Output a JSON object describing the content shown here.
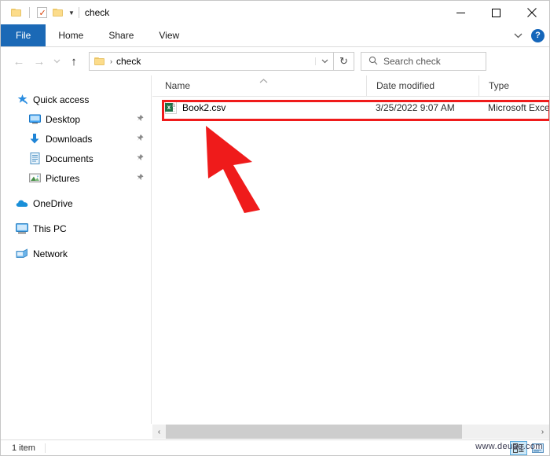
{
  "window": {
    "title": "check",
    "quick_access_toolbar": [
      {
        "name": "folder-properties",
        "icon": "folder-icon"
      },
      {
        "name": "properties",
        "icon": "properties-checkmark-icon"
      },
      {
        "name": "new-folder",
        "icon": "folder-icon"
      }
    ],
    "controls": {
      "minimize": "—",
      "maximize": "☐",
      "close": "✕"
    }
  },
  "ribbon": {
    "tabs": [
      {
        "label": "File",
        "active": true
      },
      {
        "label": "Home",
        "active": false
      },
      {
        "label": "Share",
        "active": false
      },
      {
        "label": "View",
        "active": false
      }
    ],
    "collapse_caret": "⌄",
    "help_label": "?"
  },
  "navigation": {
    "back": "←",
    "forward": "→",
    "recent": "⌄",
    "up": "↑",
    "address": {
      "folder": "check",
      "separator": "›",
      "dropdown_caret": "⌄"
    },
    "refresh": "↻",
    "search": {
      "placeholder": "Search check",
      "icon": "search-icon"
    }
  },
  "sidebar": {
    "items": [
      {
        "label": "Quick access",
        "icon": "star-pin-icon",
        "level": 0,
        "pinned": false
      },
      {
        "label": "Desktop",
        "icon": "desktop-icon",
        "level": 1,
        "pinned": true
      },
      {
        "label": "Downloads",
        "icon": "download-arrow-icon",
        "level": 1,
        "pinned": true
      },
      {
        "label": "Documents",
        "icon": "documents-icon",
        "level": 1,
        "pinned": true
      },
      {
        "label": "Pictures",
        "icon": "pictures-icon",
        "level": 1,
        "pinned": true
      },
      {
        "label": "OneDrive",
        "icon": "cloud-icon",
        "level": 0,
        "pinned": false
      },
      {
        "label": "This PC",
        "icon": "computer-icon",
        "level": 0,
        "pinned": false
      },
      {
        "label": "Network",
        "icon": "network-icon",
        "level": 0,
        "pinned": false
      }
    ],
    "pin_glyph": "📌"
  },
  "file_list": {
    "columns": [
      {
        "label": "Name",
        "sorted": "asc"
      },
      {
        "label": "Date modified",
        "sorted": ""
      },
      {
        "label": "Type",
        "sorted": ""
      }
    ],
    "sort_caret": "⌃",
    "rows": [
      {
        "name": "Book2.csv",
        "date_modified": "3/25/2022 9:07 AM",
        "type": "Microsoft Excel",
        "icon": "excel-csv-icon",
        "icon_badge": "x",
        "icon_letter": "a"
      }
    ]
  },
  "annotations": {
    "highlight_color": "#ef1b1b",
    "arrow_color": "#ef1b1b",
    "highlight_target": "Book2.csv"
  },
  "scrollbar": {
    "left_arrow": "‹",
    "right_arrow": "›"
  },
  "statusbar": {
    "item_count": "1 item",
    "views": [
      {
        "name": "details-view",
        "active": true
      },
      {
        "name": "large-icons-view",
        "active": false
      }
    ]
  },
  "watermark": "www.deuaq.com"
}
